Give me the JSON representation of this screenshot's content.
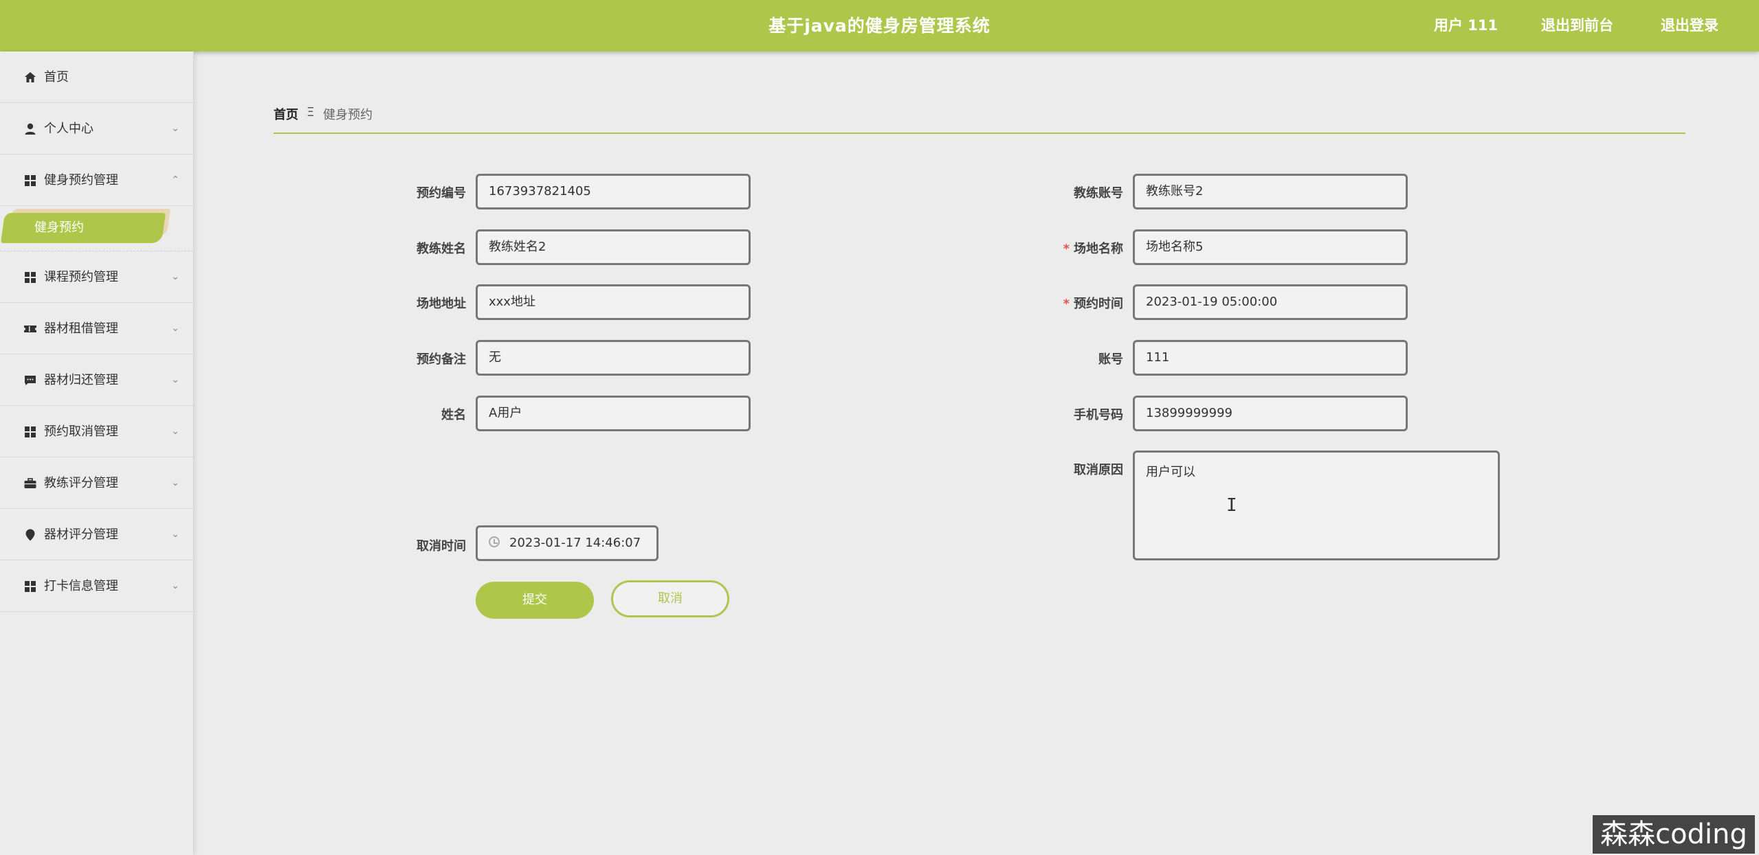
{
  "header": {
    "title": "基于java的健身房管理系统",
    "user": "用户 111",
    "exit_front": "退出到前台",
    "logout": "退出登录"
  },
  "sidebar": {
    "items": [
      {
        "label": "首页",
        "icon": "home-icon"
      },
      {
        "label": "个人中心",
        "icon": "user-icon"
      },
      {
        "label": "健身预约管理",
        "icon": "grid-icon",
        "expanded": true
      },
      {
        "label": "课程预约管理",
        "icon": "grid-icon"
      },
      {
        "label": "器材租借管理",
        "icon": "ticket-icon"
      },
      {
        "label": "器材归还管理",
        "icon": "chat-icon"
      },
      {
        "label": "预约取消管理",
        "icon": "grid-icon"
      },
      {
        "label": "教练评分管理",
        "icon": "briefcase-icon"
      },
      {
        "label": "器材评分管理",
        "icon": "pin-icon"
      },
      {
        "label": "打卡信息管理",
        "icon": "grid-icon"
      }
    ],
    "active_sub": "健身预约"
  },
  "breadcrumb": {
    "home": "首页",
    "separator": "Ξ",
    "current": "健身预约"
  },
  "form": {
    "booking_no": {
      "label": "预约编号",
      "value": "1673937821405"
    },
    "coach_name": {
      "label": "教练姓名",
      "value": "教练姓名2"
    },
    "venue_address": {
      "label": "场地地址",
      "value": "xxx地址"
    },
    "booking_note": {
      "label": "预约备注",
      "value": "无"
    },
    "name": {
      "label": "姓名",
      "value": "A用户"
    },
    "cancel_time": {
      "label": "取消时间",
      "value": "2023-01-17 14:46:07"
    },
    "coach_account": {
      "label": "教练账号",
      "value": "教练账号2"
    },
    "venue_name": {
      "label": "场地名称",
      "value": "场地名称5",
      "required": "*"
    },
    "booking_time": {
      "label": "预约时间",
      "value": "2023-01-19 05:00:00",
      "required": "*"
    },
    "account": {
      "label": "账号",
      "value": "111"
    },
    "phone": {
      "label": "手机号码",
      "value": "13899999999"
    },
    "cancel_reason": {
      "label": "取消原因",
      "value": "用户可以"
    },
    "submit_label": "提交",
    "cancel_label": "取消"
  },
  "watermark": "森森coding",
  "colors": {
    "accent": "#aec64a",
    "background": "#ececec",
    "required": "#e25555"
  }
}
